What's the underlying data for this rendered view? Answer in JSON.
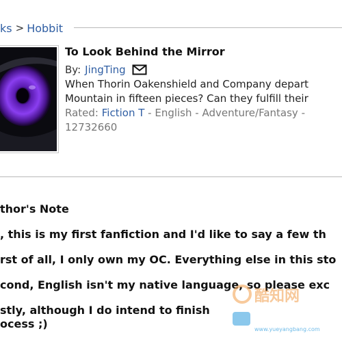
{
  "breadcrumb": {
    "parent": "ks",
    "current": "Hobbit"
  },
  "story": {
    "title": "To Look Behind the Mirror",
    "by_label": "By:",
    "author": "JingTing",
    "summary_lines": [
      "When Thorin Oakenshield and Company depart",
      "Mountain in fifteen pieces? Can they fulfill their"
    ],
    "rated_label": "Rated:",
    "rating": "Fiction T",
    "meta_rest": " - English - Adventure/Fantasy - ",
    "story_id": "12732660"
  },
  "chapter": {
    "heading": "thor's Note",
    "paragraphs": [
      ", this is my first fanfiction and I'd like to say a few th",
      "rst of all, I only own my OC. Everything else in this sto",
      "cond, English isn't my native language, so please exc",
      "stly, although I do intend to finish",
      "ocess ;)"
    ]
  },
  "icons": {
    "mail": "envelope-icon",
    "separator": "chevron-right-icon"
  },
  "watermark": {
    "text": "酷知网",
    "sub_text": "www.yueyangbang.com"
  },
  "colors": {
    "link": "#2f5ea3",
    "rule": "#b9b9b9",
    "eye_iris": "#7b2fd6"
  }
}
